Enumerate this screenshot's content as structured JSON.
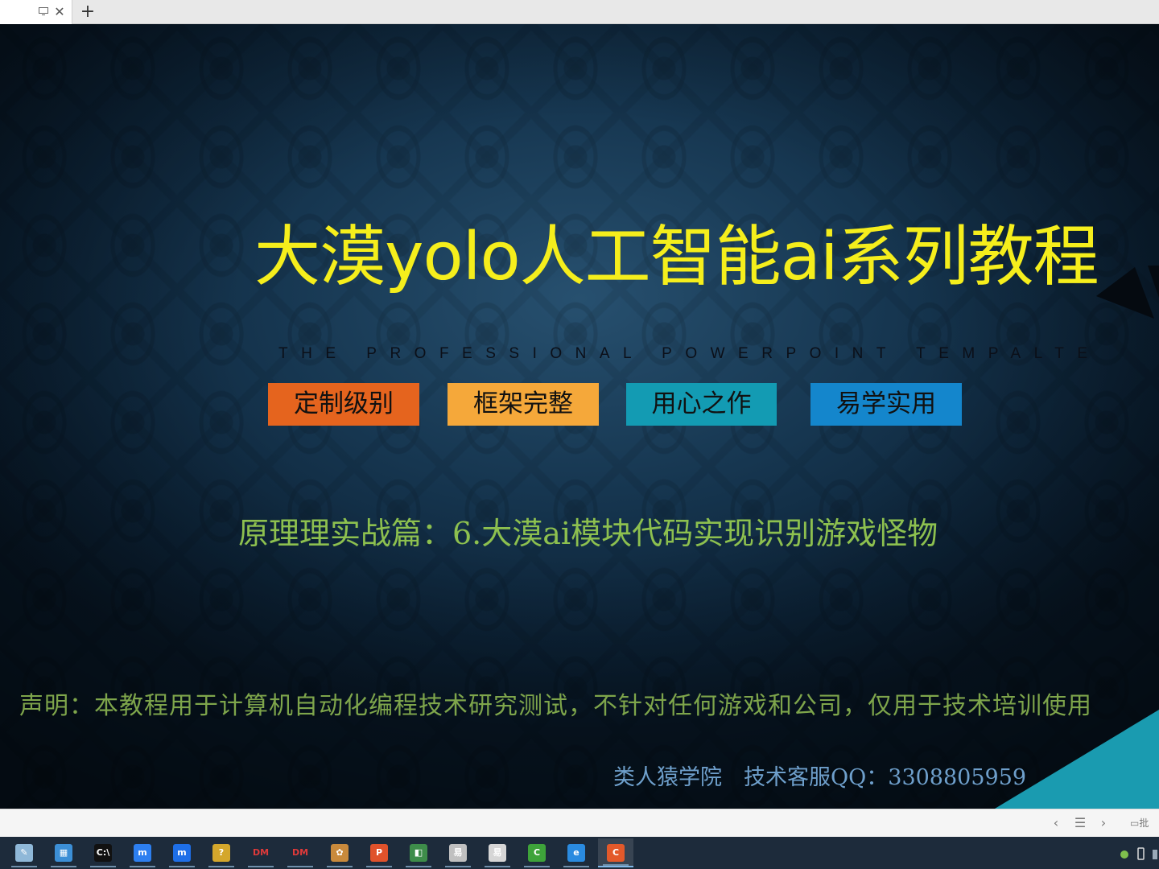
{
  "tabs": {
    "new_tab_label": "+",
    "close_label": "✕"
  },
  "slide": {
    "title": "大漠yolo人工智能ai系列教程",
    "subtitle_en": "THE PROFESSIONAL POWERPOINT TEMPALTE",
    "tags": [
      {
        "label": "定制级别",
        "color": "#e5641e"
      },
      {
        "label": "框架完整",
        "color": "#f5a83a"
      },
      {
        "label": "用心之作",
        "color": "#139bb3"
      },
      {
        "label": "易学实用",
        "color": "#1486cc"
      }
    ],
    "lesson": "原理理实战篇：6.大漠ai模块代码实现识别游戏怪物",
    "disclaimer": "声明：本教程用于计算机自动化编程技术研究测试，不针对任何游戏和公司，仅用于技术培训使用",
    "credits": "类人猿学院　技术客服QQ：3308805959",
    "colors": {
      "title": "#f5ee1c",
      "lesson": "#8dc04f",
      "disclaimer": "#7ea54b",
      "credits": "#6e9fcb",
      "teal_corner": "#1a9bb0"
    }
  },
  "controls": {
    "prev": "‹",
    "list": "☰",
    "next": "›",
    "note": "批"
  },
  "taskbar": {
    "items": [
      {
        "name": "taskbar-pencil-app",
        "glyph": "✎",
        "color": "#8fb8d8"
      },
      {
        "name": "taskbar-control-panel",
        "glyph": "▦",
        "color": "#3c8fd6"
      },
      {
        "name": "taskbar-cmd",
        "glyph": "C:\\",
        "color": "#111111"
      },
      {
        "name": "taskbar-chat-app-1",
        "glyph": "m",
        "color": "#2d7ff0"
      },
      {
        "name": "taskbar-chat-app-2",
        "glyph": "m",
        "color": "#1e6fe8"
      },
      {
        "name": "taskbar-help-tool",
        "glyph": "?",
        "color": "#d4a72c"
      },
      {
        "name": "taskbar-dm-1",
        "glyph": "DM",
        "color": "#1d2b3b"
      },
      {
        "name": "taskbar-dm-2",
        "glyph": "DM",
        "color": "#1d2b3b"
      },
      {
        "name": "taskbar-paint",
        "glyph": "✿",
        "color": "#c98a3c"
      },
      {
        "name": "taskbar-powerpoint",
        "glyph": "P",
        "color": "#e0522b"
      },
      {
        "name": "taskbar-installer",
        "glyph": "◧",
        "color": "#3e8d4a"
      },
      {
        "name": "taskbar-notepad-1",
        "glyph": "易",
        "color": "#c0c0c0"
      },
      {
        "name": "taskbar-notepad-2",
        "glyph": "易",
        "color": "#d6d6d6"
      },
      {
        "name": "taskbar-camtasia-green",
        "glyph": "C",
        "color": "#3ea33a"
      },
      {
        "name": "taskbar-browser",
        "glyph": "e",
        "color": "#2a8be0"
      },
      {
        "name": "taskbar-camtasia-orange",
        "glyph": "C",
        "color": "#e3592a"
      }
    ]
  }
}
